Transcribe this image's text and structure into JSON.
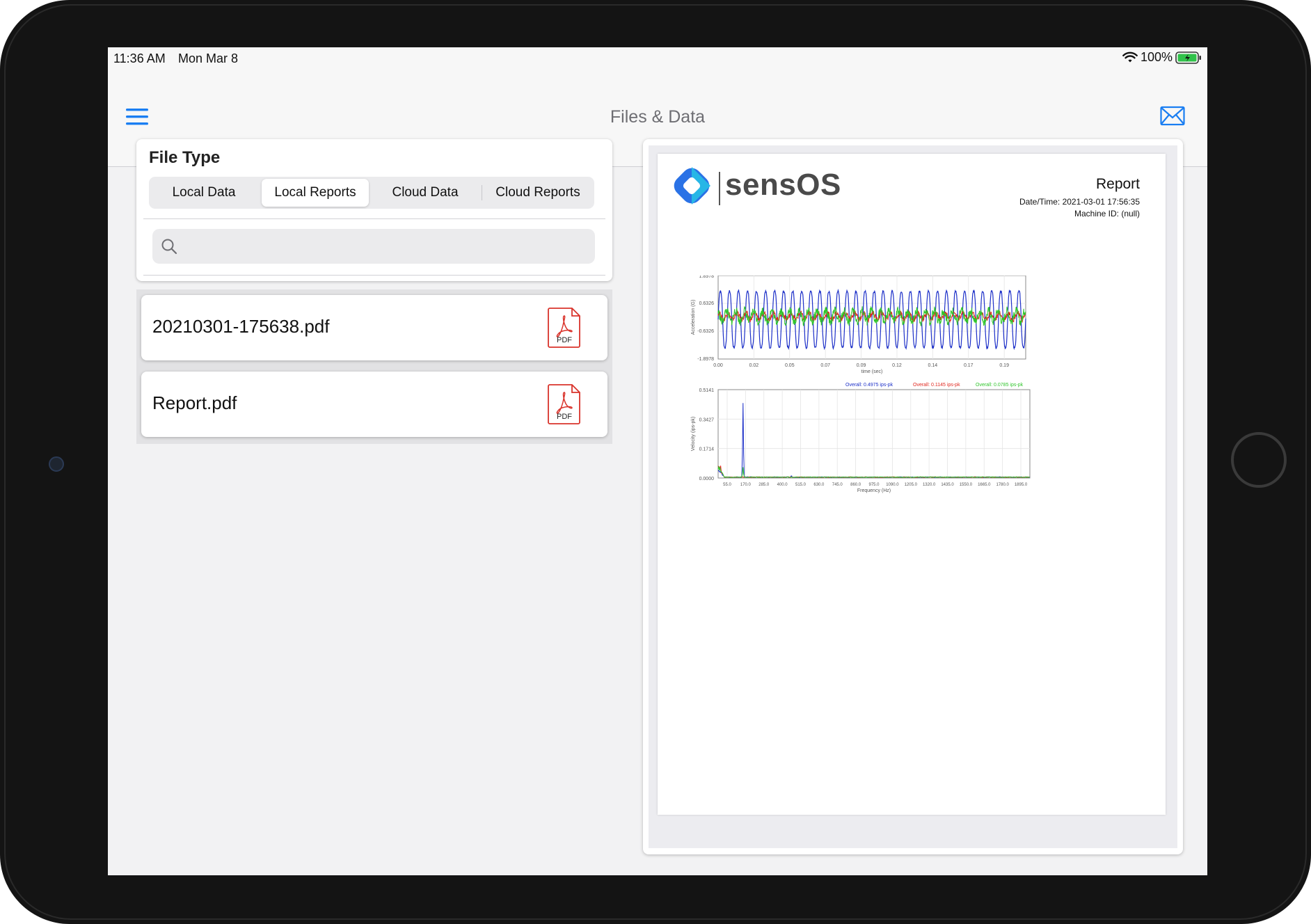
{
  "status_bar": {
    "time": "11:36 AM",
    "date": "Mon Mar 8",
    "battery": "100%"
  },
  "nav": {
    "title": "Files & Data",
    "menu_icon": "hamburger-icon",
    "mail_icon": "mail-icon"
  },
  "file_type": {
    "title": "File Type",
    "segments": [
      "Local Data",
      "Local Reports",
      "Cloud Data",
      "Cloud Reports"
    ],
    "selected": "Local Reports",
    "search_placeholder": ""
  },
  "files": [
    {
      "name": "20210301-175638.pdf",
      "icon": "pdf-icon",
      "icon_label": "PDF",
      "selected": true
    },
    {
      "name": "Report.pdf",
      "icon": "pdf-icon",
      "icon_label": "PDF",
      "selected": false
    }
  ],
  "preview": {
    "brand": "sensOS",
    "report_title": "Report",
    "datetime": "Date/Time: 2021-03-01 17:56:35",
    "machine_id": "Machine ID: (null)"
  },
  "colors": {
    "accent": "#1a7ef2",
    "series_blue": "#1c2fc8",
    "series_red": "#e0261d",
    "series_green": "#2fc52a",
    "logo_cyan": "#27b6e6",
    "logo_blue": "#2a72e6"
  },
  "chart_data": [
    {
      "type": "line",
      "xlabel": "time (sec)",
      "ylabel": "Acceleration (G)",
      "ylim": [
        -1.8978,
        1.8978
      ],
      "ytick_labels": [
        "1.8978",
        "0.6326",
        "-0.6326",
        "-1.8978"
      ],
      "xtick_labels": [
        "0.00",
        "0.02",
        "0.05",
        "0.07",
        "0.09",
        "0.12",
        "0.14",
        "0.17",
        "0.19"
      ],
      "xlim": [
        0,
        0.21
      ],
      "grid": true,
      "series": [
        {
          "color": "#1c2fc8",
          "cycles": 34,
          "amplitude": 1.4
        },
        {
          "color": "#e0261d",
          "cycles": 34,
          "amplitude": 0.15
        },
        {
          "color": "#2fc52a",
          "cycles": 34,
          "amplitude": 0.25
        }
      ]
    },
    {
      "type": "line",
      "xlabel": "Frequency (Hz)",
      "ylabel": "Velocity (ips-pk)",
      "ylim": [
        0,
        0.5141
      ],
      "ytick_labels": [
        "0.5141",
        "0.3427",
        "0.1714",
        "0.0000"
      ],
      "xtick_labels": [
        "55.0",
        "170.0",
        "285.0",
        "400.0",
        "515.0",
        "630.0",
        "745.0",
        "860.0",
        "975.0",
        "1090.0",
        "1205.0",
        "1320.0",
        "1435.0",
        "1550.0",
        "1665.0",
        "1780.0",
        "1895.0"
      ],
      "grid": true,
      "legend_position": "top",
      "series": [
        {
          "name": "Overall: 0.4975 ips-pk",
          "color": "#1c2fc8",
          "peak_hz": 160,
          "peak": 0.43
        },
        {
          "name": "Overall: 0.1145 ips-pk",
          "color": "#e0261d",
          "peak_hz": 5,
          "peak": 0.09
        },
        {
          "name": "Overall: 0.0785 ips-pk",
          "color": "#2fc52a",
          "peak_hz": 160,
          "peak": 0.06
        }
      ]
    }
  ]
}
